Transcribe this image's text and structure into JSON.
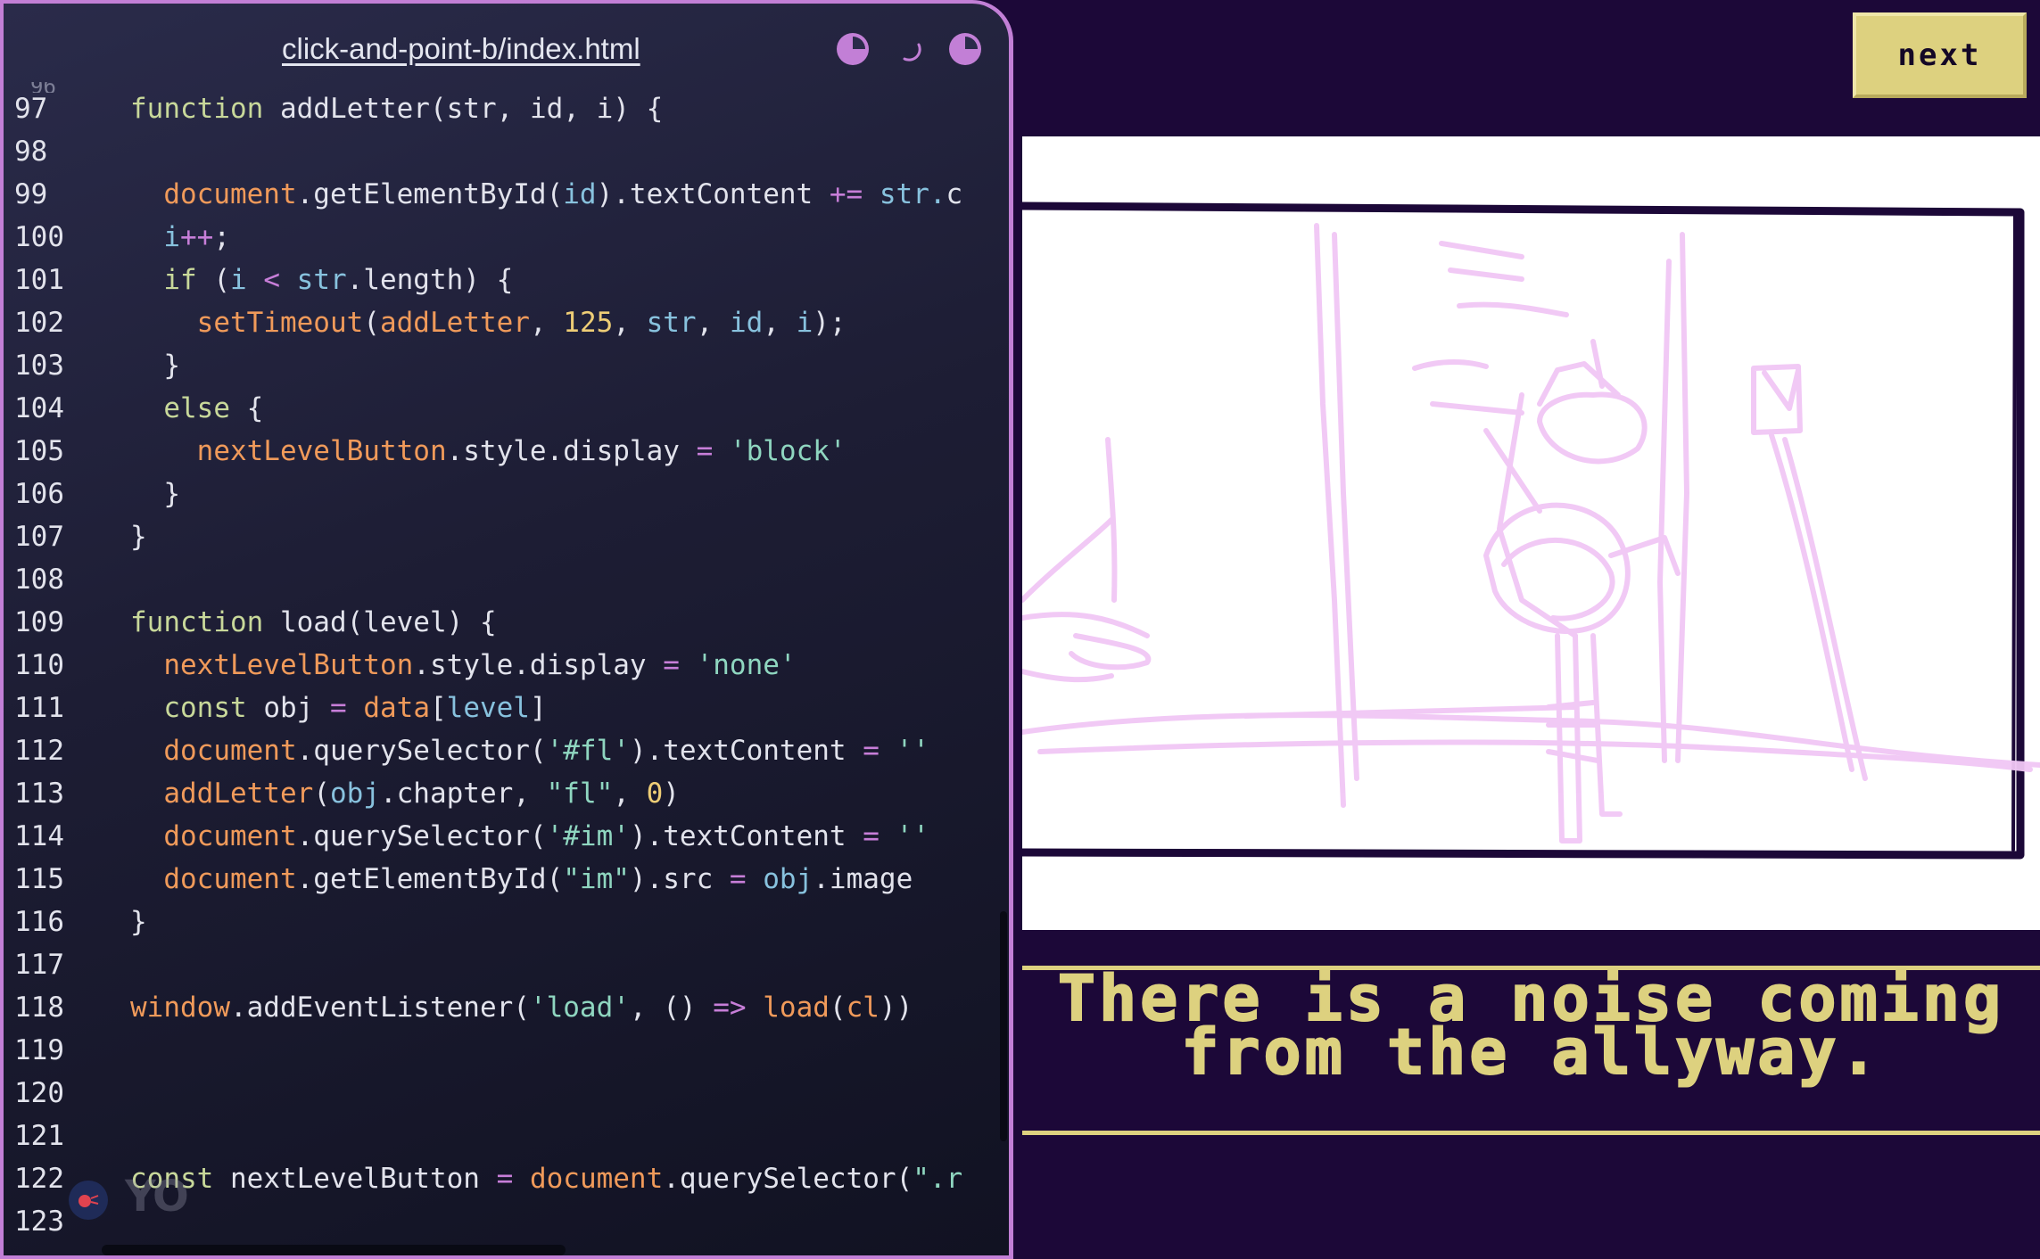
{
  "editor": {
    "file_title": "click-and-point-b/index.html",
    "icons": [
      "half-moon-icon",
      "loading-spinner-icon",
      "half-moon-icon"
    ],
    "first_partial_line": "96",
    "lines": [
      {
        "n": "97",
        "tokens": [
          [
            "function ",
            "kw"
          ],
          [
            "addLetter",
            ""
          ],
          [
            "(str, id, i) {",
            ""
          ]
        ]
      },
      {
        "n": "98",
        "tokens": []
      },
      {
        "n": "99",
        "tokens": [
          [
            "  document",
            "fn"
          ],
          [
            ".getElementById(",
            ""
          ],
          [
            "id",
            "var"
          ],
          [
            ").textContent ",
            ""
          ],
          [
            "+=",
            "op"
          ],
          [
            " str.",
            "var"
          ],
          [
            "c",
            ""
          ]
        ]
      },
      {
        "n": "100",
        "tokens": [
          [
            "  i",
            "var"
          ],
          [
            "++",
            "op"
          ],
          [
            ";",
            ""
          ]
        ]
      },
      {
        "n": "101",
        "tokens": [
          [
            "  if",
            "kw"
          ],
          [
            " (",
            ""
          ],
          [
            "i",
            "var"
          ],
          [
            " < ",
            "op"
          ],
          [
            "str",
            "var"
          ],
          [
            ".length) {",
            ""
          ]
        ]
      },
      {
        "n": "102",
        "tokens": [
          [
            "    setTimeout",
            "fn"
          ],
          [
            "(",
            ""
          ],
          [
            "addLetter",
            "fn"
          ],
          [
            ", ",
            ""
          ],
          [
            "125",
            "num"
          ],
          [
            ", ",
            ""
          ],
          [
            "str",
            "var"
          ],
          [
            ", ",
            ""
          ],
          [
            "id",
            "var"
          ],
          [
            ", ",
            ""
          ],
          [
            "i",
            "var"
          ],
          [
            ");",
            ""
          ]
        ]
      },
      {
        "n": "103",
        "tokens": [
          [
            "  }",
            ""
          ]
        ]
      },
      {
        "n": "104",
        "tokens": [
          [
            "  else",
            "kw"
          ],
          [
            " {",
            ""
          ]
        ]
      },
      {
        "n": "105",
        "tokens": [
          [
            "    nextLevelButton",
            "fn"
          ],
          [
            ".style.display ",
            ""
          ],
          [
            "=",
            "op"
          ],
          [
            " ",
            ""
          ],
          [
            "'block'",
            "str"
          ]
        ]
      },
      {
        "n": "106",
        "tokens": [
          [
            "  }",
            ""
          ]
        ]
      },
      {
        "n": "107",
        "tokens": [
          [
            "}",
            ""
          ]
        ]
      },
      {
        "n": "108",
        "tokens": []
      },
      {
        "n": "109",
        "tokens": [
          [
            "function ",
            "kw"
          ],
          [
            "load",
            ""
          ],
          [
            "(level) {",
            ""
          ]
        ]
      },
      {
        "n": "110",
        "tokens": [
          [
            "  nextLevelButton",
            "fn"
          ],
          [
            ".style.display ",
            ""
          ],
          [
            "=",
            "op"
          ],
          [
            " ",
            ""
          ],
          [
            "'none'",
            "str"
          ]
        ]
      },
      {
        "n": "111",
        "tokens": [
          [
            "  const",
            "kw"
          ],
          [
            " obj ",
            ""
          ],
          [
            "=",
            "op"
          ],
          [
            " ",
            ""
          ],
          [
            "data",
            "fn"
          ],
          [
            "[",
            ""
          ],
          [
            "level",
            "var"
          ],
          [
            "]",
            ""
          ]
        ]
      },
      {
        "n": "112",
        "tokens": [
          [
            "  document",
            "fn"
          ],
          [
            ".querySelector(",
            ""
          ],
          [
            "'#fl'",
            "str"
          ],
          [
            ").textContent ",
            ""
          ],
          [
            "=",
            "op"
          ],
          [
            " ",
            ""
          ],
          [
            "''",
            "str"
          ]
        ]
      },
      {
        "n": "113",
        "tokens": [
          [
            "  addLetter",
            "fn"
          ],
          [
            "(",
            ""
          ],
          [
            "obj",
            "var"
          ],
          [
            ".chapter, ",
            ""
          ],
          [
            "\"fl\"",
            "str"
          ],
          [
            ", ",
            ""
          ],
          [
            "0",
            "num"
          ],
          [
            ")",
            ""
          ]
        ]
      },
      {
        "n": "114",
        "tokens": [
          [
            "  document",
            "fn"
          ],
          [
            ".querySelector(",
            ""
          ],
          [
            "'#im'",
            "str"
          ],
          [
            ").textContent ",
            ""
          ],
          [
            "=",
            "op"
          ],
          [
            " ",
            ""
          ],
          [
            "''",
            "str"
          ]
        ]
      },
      {
        "n": "115",
        "tokens": [
          [
            "  document",
            "fn"
          ],
          [
            ".getElementById(",
            ""
          ],
          [
            "\"im\"",
            "str"
          ],
          [
            ").src ",
            ""
          ],
          [
            "=",
            "op"
          ],
          [
            " ",
            ""
          ],
          [
            "obj",
            "var"
          ],
          [
            ".image",
            ""
          ]
        ]
      },
      {
        "n": "116",
        "tokens": [
          [
            "}",
            ""
          ]
        ]
      },
      {
        "n": "117",
        "tokens": []
      },
      {
        "n": "118",
        "tokens": [
          [
            "window",
            "fn"
          ],
          [
            ".addEventListener(",
            ""
          ],
          [
            "'load'",
            "str"
          ],
          [
            ", () ",
            ""
          ],
          [
            "=>",
            "op"
          ],
          [
            " ",
            ""
          ],
          [
            "load",
            "fn"
          ],
          [
            "(",
            ""
          ],
          [
            "cl",
            "fn"
          ],
          [
            "))",
            ""
          ]
        ]
      },
      {
        "n": "119",
        "tokens": []
      },
      {
        "n": "120",
        "tokens": []
      },
      {
        "n": "121",
        "tokens": []
      },
      {
        "n": "122",
        "tokens": [
          [
            "const",
            "kw"
          ],
          [
            " nextLevelButton ",
            ""
          ],
          [
            "=",
            "op"
          ],
          [
            " ",
            ""
          ],
          [
            "document",
            "fn"
          ],
          [
            ".querySelector(",
            ""
          ],
          [
            "\".r",
            "str"
          ]
        ]
      },
      {
        "n": "123",
        "tokens": []
      }
    ],
    "watermark": "YO",
    "colors": {
      "border": "#c27fd6",
      "background": "#1d1d34"
    }
  },
  "game": {
    "next_button_label": "next",
    "narration": "There is a noise coming from the allyway.",
    "colors": {
      "background": "#1c0838",
      "accent": "#ddd17f",
      "sketch": "#f1c7f5"
    }
  }
}
